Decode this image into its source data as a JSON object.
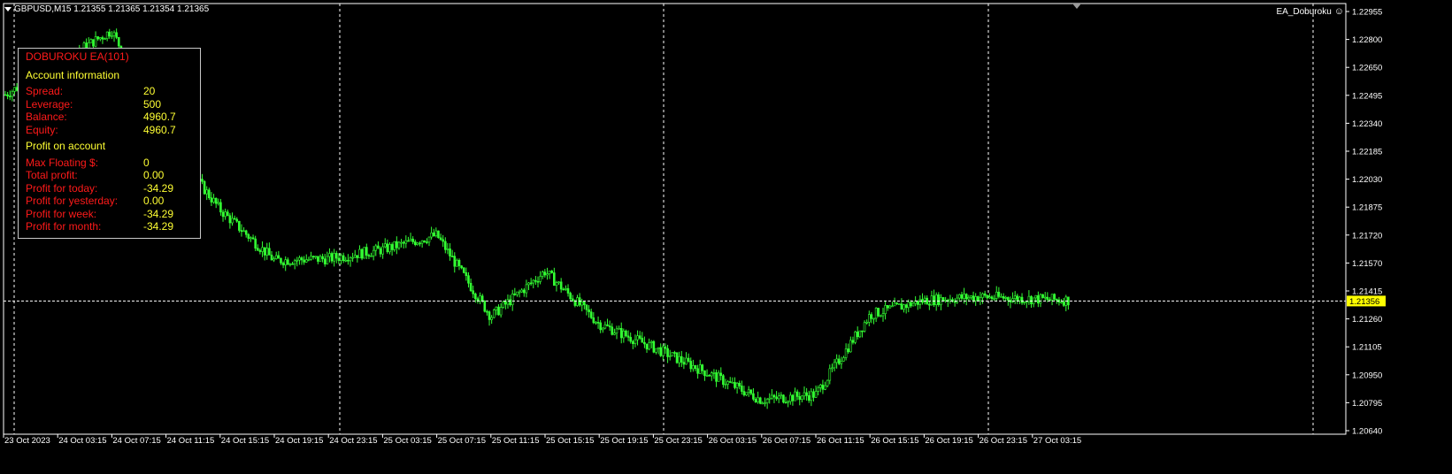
{
  "chart": {
    "symbol_line": "GBPUSD,M15  1.21355 1.21365 1.21354 1.21365",
    "ea_name": "EA_Doburoku",
    "smiley_icon": "smiley-icon",
    "current_price_label": "1.21356",
    "colors": {
      "background": "#000000",
      "candles": "#33ff33",
      "grid": "#ffffff",
      "price_tag_bg": "#ffff00",
      "text": "#ffffff"
    }
  },
  "panel": {
    "title": "DOBUROKU EA(101)",
    "account_heading": "Account information",
    "account_rows": [
      {
        "label": "Spread:",
        "value": "20"
      },
      {
        "label": "Leverage:",
        "value": "500"
      },
      {
        "label": "Balance:",
        "value": "4960.7"
      },
      {
        "label": "Equity:",
        "value": "4960.7"
      }
    ],
    "profit_heading": "Profit on account",
    "profit_rows": [
      {
        "label": "Max Floating $:",
        "value": "0"
      },
      {
        "label": "Total profit:",
        "value": "0.00"
      },
      {
        "label": "Profit for today:",
        "value": "-34.29"
      },
      {
        "label": "Profit for yesterday:",
        "value": "0.00"
      },
      {
        "label": "Profit for week:",
        "value": "-34.29"
      },
      {
        "label": "Profit for month:",
        "value": "-34.29"
      }
    ]
  },
  "chart_data": {
    "type": "candlestick",
    "price_axis_labels": [
      "1.22955",
      "1.22800",
      "1.22650",
      "1.22495",
      "1.22340",
      "1.22185",
      "1.22030",
      "1.21875",
      "1.21720",
      "1.21570",
      "1.21415",
      "1.21260",
      "1.21105",
      "1.20950",
      "1.20795",
      "1.20640"
    ],
    "time_axis_labels": [
      "23 Oct 2023",
      "24 Oct 03:15",
      "24 Oct 07:15",
      "24 Oct 11:15",
      "24 Oct 15:15",
      "24 Oct 19:15",
      "24 Oct 23:15",
      "25 Oct 03:15",
      "25 Oct 07:15",
      "25 Oct 11:15",
      "25 Oct 15:15",
      "25 Oct 19:15",
      "25 Oct 23:15",
      "26 Oct 03:15",
      "26 Oct 07:15",
      "26 Oct 11:15",
      "26 Oct 15:15",
      "26 Oct 19:15",
      "26 Oct 23:15",
      "27 Oct 03:15"
    ],
    "y_range": [
      1.2064,
      1.22955
    ],
    "current_price": 1.21356,
    "close_path_approx": [
      {
        "t": "23 Oct 2023",
        "close": 1.2249
      },
      {
        "t": "24 Oct 07:15",
        "close": 1.2285
      },
      {
        "t": "24 Oct 11:15",
        "close": 1.2225
      },
      {
        "t": "24 Oct 15:15",
        "close": 1.2186
      },
      {
        "t": "24 Oct 19:15",
        "close": 1.2158
      },
      {
        "t": "24 Oct 23:15",
        "close": 1.2159
      },
      {
        "t": "25 Oct 03:15",
        "close": 1.2164
      },
      {
        "t": "25 Oct 07:15",
        "close": 1.2172
      },
      {
        "t": "25 Oct 11:15",
        "close": 1.2127
      },
      {
        "t": "25 Oct 15:15",
        "close": 1.2152
      },
      {
        "t": "25 Oct 19:15",
        "close": 1.2123
      },
      {
        "t": "25 Oct 23:15",
        "close": 1.211
      },
      {
        "t": "26 Oct 03:15",
        "close": 1.2096
      },
      {
        "t": "26 Oct 07:15",
        "close": 1.2081
      },
      {
        "t": "26 Oct 11:15",
        "close": 1.2084
      },
      {
        "t": "26 Oct 15:15",
        "close": 1.2128
      },
      {
        "t": "26 Oct 19:15",
        "close": 1.2136
      },
      {
        "t": "26 Oct 23:15",
        "close": 1.2138
      },
      {
        "t": "27 Oct 03:15",
        "close": 1.2136
      }
    ]
  }
}
